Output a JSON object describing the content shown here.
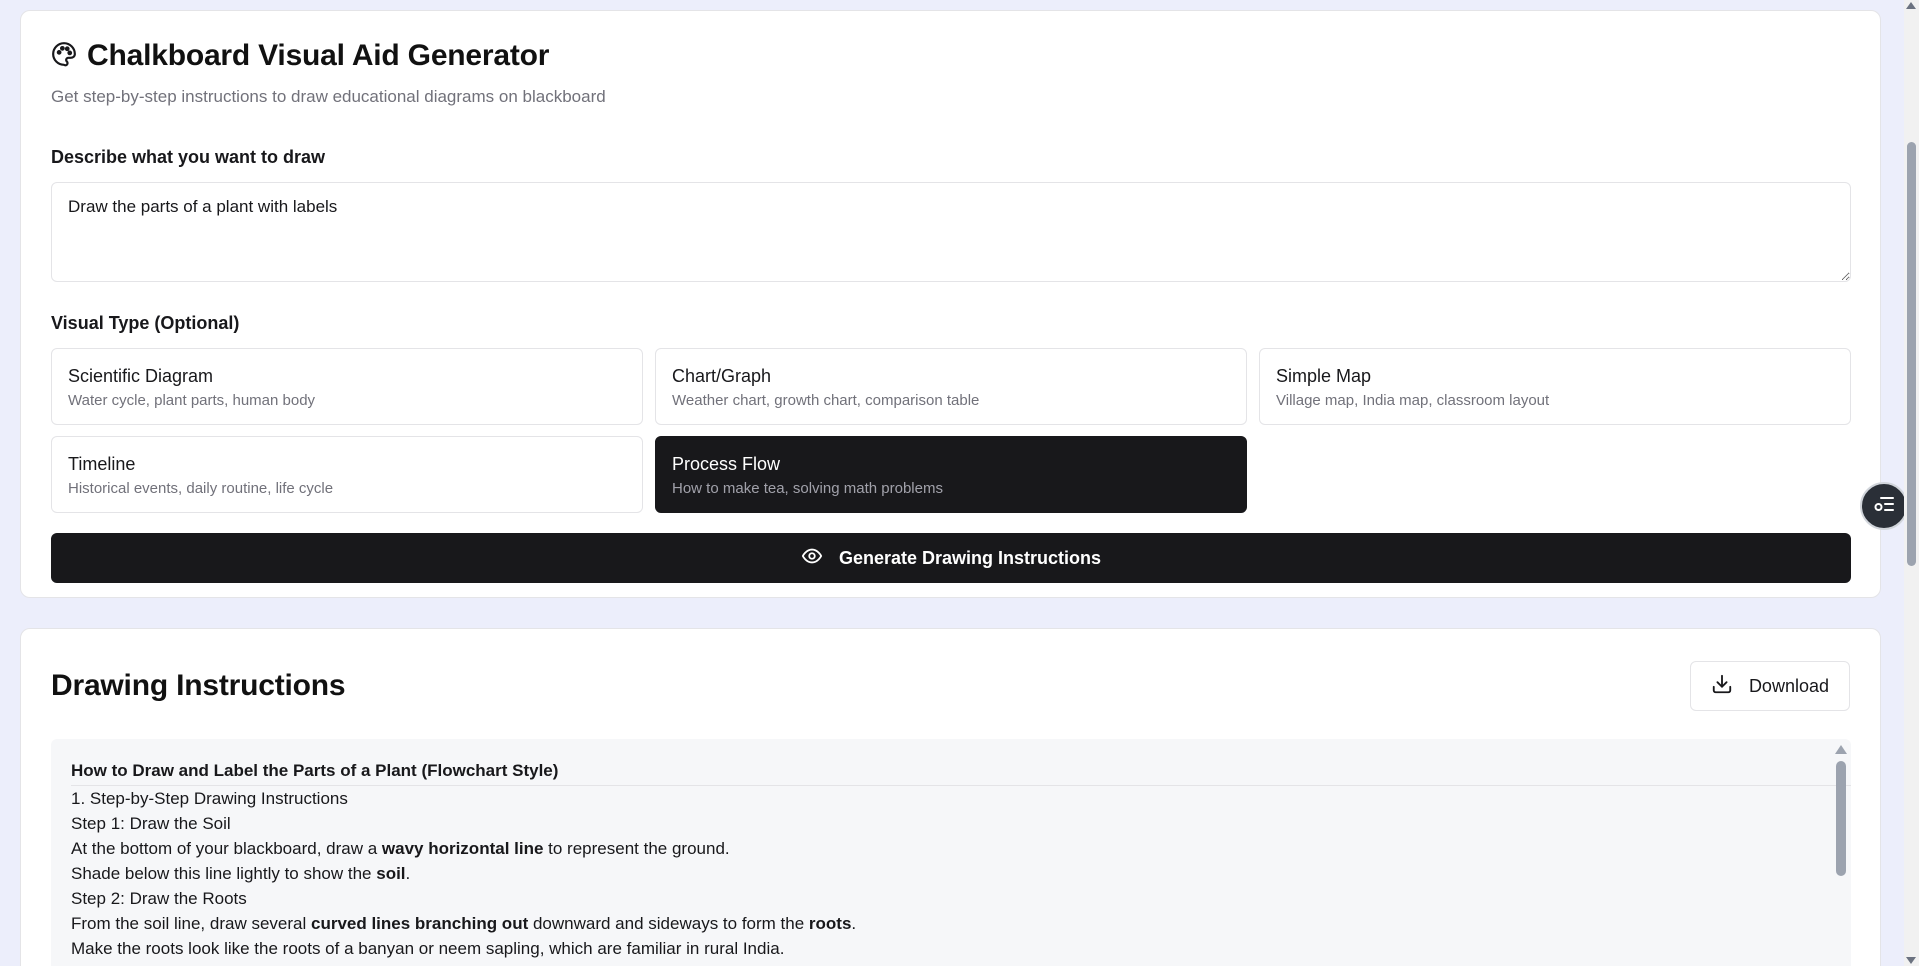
{
  "generator": {
    "title": "Chalkboard Visual Aid Generator",
    "subtitle": "Get step-by-step instructions to draw educational diagrams on blackboard",
    "describe_label": "Describe what you want to draw",
    "describe_value": "Draw the parts of a plant with labels",
    "visual_type_label": "Visual Type (Optional)",
    "visual_types": [
      {
        "name": "Scientific Diagram",
        "desc": "Water cycle, plant parts, human body"
      },
      {
        "name": "Chart/Graph",
        "desc": "Weather chart, growth chart, comparison table"
      },
      {
        "name": "Simple Map",
        "desc": "Village map, India map, classroom layout"
      },
      {
        "name": "Timeline",
        "desc": "Historical events, daily routine, life cycle"
      },
      {
        "name": "Process Flow",
        "desc": "How to make tea, solving math problems"
      }
    ],
    "selected_type": "Process Flow",
    "generate_label": "Generate Drawing Instructions"
  },
  "instructions": {
    "title": "Drawing Instructions",
    "download_label": "Download",
    "heading": "How to Draw and Label the Parts of a Plant (Flowchart Style)",
    "lines": [
      {
        "pre": "1. Step-by-Step Drawing Instructions",
        "bold": "",
        "post": ""
      },
      {
        "pre": "Step 1: Draw the Soil",
        "bold": "",
        "post": ""
      },
      {
        "pre": "At the bottom of your blackboard, draw a ",
        "bold": "wavy horizontal line",
        "post": " to represent the ground."
      },
      {
        "pre": "Shade below this line lightly to show the ",
        "bold": "soil",
        "post": "."
      },
      {
        "pre": "Step 2: Draw the Roots",
        "bold": "",
        "post": ""
      },
      {
        "pre": "From the soil line, draw several ",
        "bold": "curved lines branching out",
        "post": " downward and sideways to form the ",
        "bold2": "roots",
        "post2": "."
      },
      {
        "pre": "Make the roots look like the roots of a banyan or neem sapling, which are familiar in rural India.",
        "bold": "",
        "post": ""
      }
    ]
  },
  "colors": {
    "background": "#eceefb",
    "primary": "#18181b",
    "muted_text": "#71717a",
    "border": "#e4e4e7"
  },
  "icons": {
    "title_icon": "palette-icon",
    "generate_icon": "eye-icon",
    "download_icon": "download-icon",
    "floating_icon": "list-settings-icon"
  }
}
